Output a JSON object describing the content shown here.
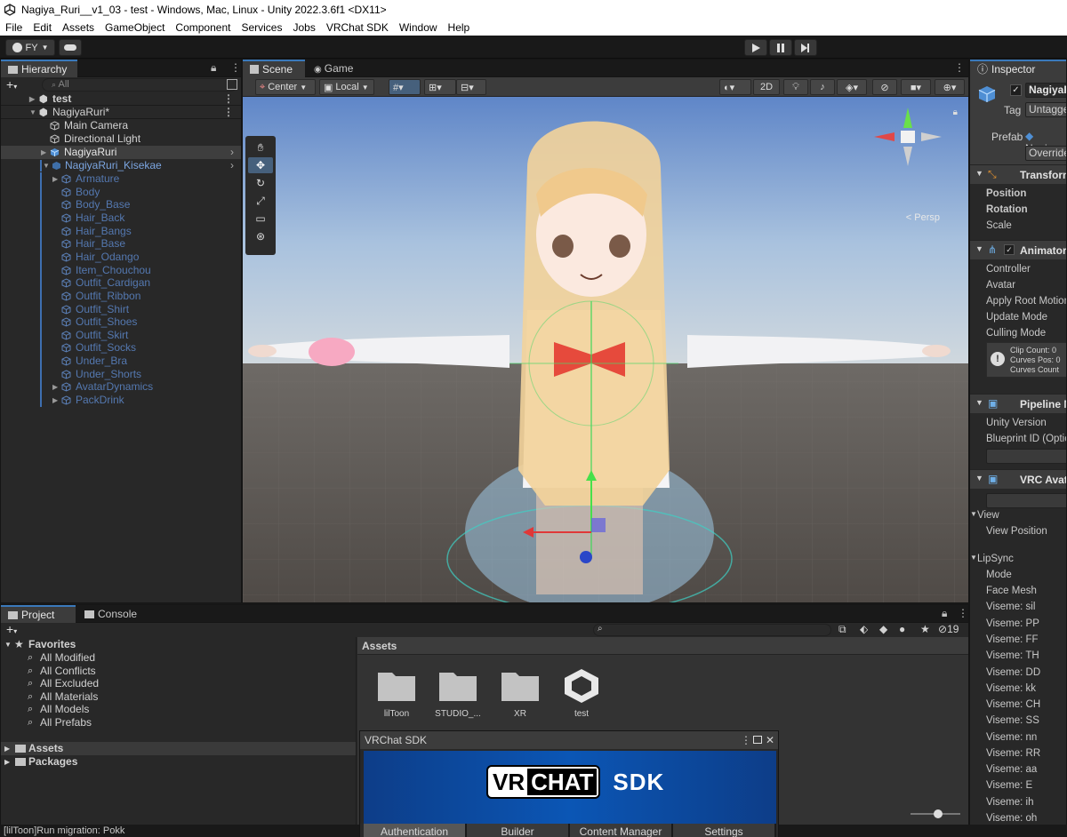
{
  "window": {
    "title": "Nagiya_Ruri__v1_03 - test - Windows, Mac, Linux - Unity 2022.3.6f1 <DX11>"
  },
  "menu": [
    "File",
    "Edit",
    "Assets",
    "GameObject",
    "Component",
    "Services",
    "Jobs",
    "VRChat SDK",
    "Window",
    "Help"
  ],
  "toolbar": {
    "account": "FY"
  },
  "hierarchy": {
    "tab": "Hierarchy",
    "search_placeholder": "All",
    "items": [
      {
        "label": "test"
      },
      {
        "label": "NagiyaRuri*"
      },
      {
        "label": "Main Camera"
      },
      {
        "label": "Directional Light"
      },
      {
        "label": "NagiyaRuri"
      },
      {
        "label": "NagiyaRuri_Kisekae"
      },
      {
        "label": "Armature"
      },
      {
        "label": "Body"
      },
      {
        "label": "Body_Base"
      },
      {
        "label": "Hair_Back"
      },
      {
        "label": "Hair_Bangs"
      },
      {
        "label": "Hair_Base"
      },
      {
        "label": "Hair_Odango"
      },
      {
        "label": "Item_Chouchou"
      },
      {
        "label": "Outfit_Cardigan"
      },
      {
        "label": "Outfit_Ribbon"
      },
      {
        "label": "Outfit_Shirt"
      },
      {
        "label": "Outfit_Shoes"
      },
      {
        "label": "Outfit_Skirt"
      },
      {
        "label": "Outfit_Socks"
      },
      {
        "label": "Under_Bra"
      },
      {
        "label": "Under_Shorts"
      },
      {
        "label": "AvatarDynamics"
      },
      {
        "label": "PackDrink"
      }
    ]
  },
  "scene": {
    "tabs": [
      "Scene",
      "Game"
    ],
    "pivot": "Center",
    "space": "Local",
    "mode_2d": "2D",
    "persp": "< Persp"
  },
  "inspector": {
    "tab": "Inspector",
    "object_name": "NagiyaR",
    "tag_label": "Tag",
    "tag_value": "Untagge",
    "prefab_label": "Prefab",
    "prefab_value": "Nagiya",
    "overrides": "Override",
    "transform": {
      "title": "Transform",
      "rows": [
        "Position",
        "Rotation",
        "Scale"
      ]
    },
    "animator": {
      "title": "Animator",
      "rows": [
        "Controller",
        "Avatar",
        "Apply Root Motion",
        "Update Mode",
        "Culling Mode"
      ],
      "info": [
        "Clip Count: 0",
        "Curves Pos: 0",
        "Curves Count"
      ]
    },
    "pipeline": {
      "title": "Pipeline M",
      "rows": [
        "Unity Version",
        "Blueprint ID (Optic"
      ]
    },
    "vrc_avatar": {
      "title": "VRC Avata",
      "rows": [
        "View",
        "View Position",
        "LipSync",
        "Mode",
        "Face Mesh",
        "Viseme: sil",
        "Viseme: PP",
        "Viseme: FF",
        "Viseme: TH",
        "Viseme: DD",
        "Viseme: kk",
        "Viseme: CH",
        "Viseme: SS",
        "Viseme: nn",
        "Viseme: RR",
        "Viseme: aa",
        "Viseme: E",
        "Viseme: ih",
        "Viseme: oh"
      ]
    }
  },
  "project": {
    "tabs": [
      "Project",
      "Console"
    ],
    "favorites_label": "Favorites",
    "favorites": [
      "All Modified",
      "All Conflicts",
      "All Excluded",
      "All Materials",
      "All Models",
      "All Prefabs"
    ],
    "roots": [
      "Assets",
      "Packages"
    ],
    "assets_header": "Assets",
    "hidden_count": "19",
    "assets": [
      {
        "label": "lilToon",
        "icon": "folder-icon"
      },
      {
        "label": "STUDIO_...",
        "icon": "folder-icon"
      },
      {
        "label": "XR",
        "icon": "folder-icon"
      },
      {
        "label": "test",
        "icon": "unity-scene-icon"
      }
    ]
  },
  "vrchat_sdk": {
    "title": "VRChat SDK",
    "banner_vr": "VR",
    "banner_chat": "CHAT",
    "banner_sdk": "SDK",
    "tabs": [
      "Authentication",
      "Builder",
      "Content Manager",
      "Settings"
    ],
    "active_tab": "Authentication"
  },
  "status": {
    "message": "[lilToon]Run migration: Pokk"
  }
}
